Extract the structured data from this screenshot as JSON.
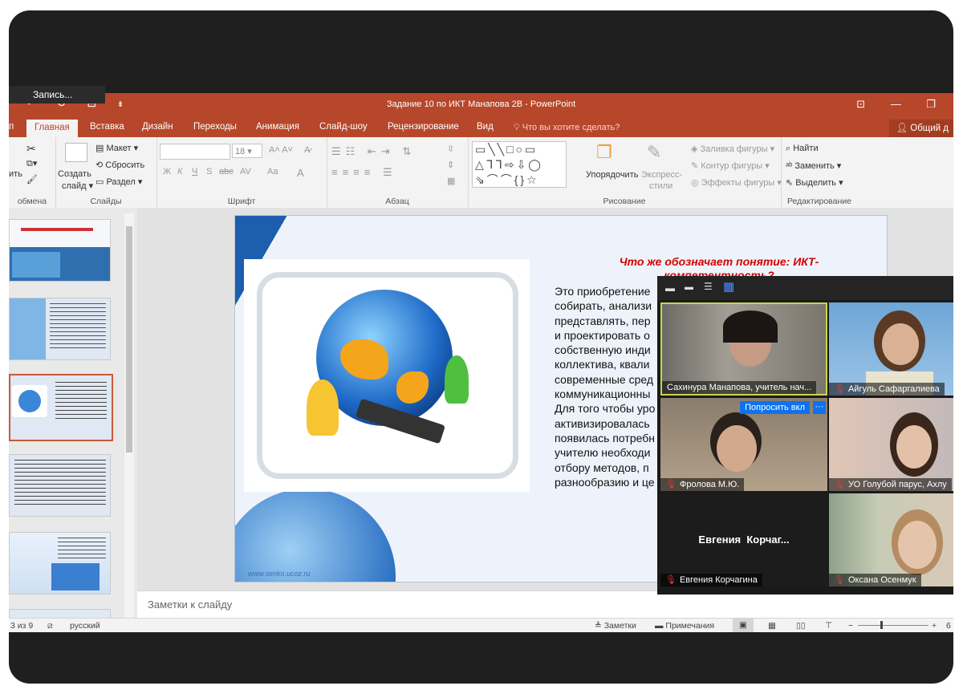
{
  "recording_label": "Запись...",
  "window": {
    "title": "Задание 10 по ИКТ Манапова 2В - PowerPoint",
    "controls": [
      "⊡",
      "—",
      "❐"
    ]
  },
  "qat": {
    "undo": "↶",
    "redo": "↻",
    "present": "⊡",
    "more": "⇟"
  },
  "tabs": {
    "file_stub": "п",
    "home": "Главная",
    "insert": "Вставка",
    "design": "Дизайн",
    "transitions": "Переходы",
    "animation": "Анимация",
    "slideshow": "Слайд-шоу",
    "review": "Рецензирование",
    "view": "Вид",
    "tell_me": "Что вы хотите сделать?",
    "share": "Общий д"
  },
  "ribbon": {
    "clipboard": {
      "paste_stub": "ить",
      "label": "обмена"
    },
    "slides": {
      "new_slide": "Создать",
      "new_slide_2": "слайд",
      "layout": "Макет",
      "reset": "Сбросить",
      "section": "Раздел",
      "label": "Слайды"
    },
    "font": {
      "name": "",
      "size": "18",
      "label": "Шрифт",
      "bold": "Ж",
      "italic": "К",
      "underline": "Ч",
      "strike": "S",
      "abc": "abc",
      "spacing": "AV",
      "case": "Aa",
      "color": "A"
    },
    "paragraph": {
      "label": "Абзац"
    },
    "drawing": {
      "arrange": "Упорядочить",
      "quick_styles": "Экспресс-",
      "quick_styles_2": "стили",
      "fill": "Заливка фигуры",
      "outline": "Контур фигуры",
      "effects": "Эффекты фигуры",
      "label": "Рисование"
    },
    "editing": {
      "find": "Найти",
      "replace": "Заменить",
      "select": "Выделить",
      "label": "Редактирование"
    }
  },
  "slide": {
    "title": "Что же обозначает понятие: ИКТ-компетентность?",
    "title_line1": "Что же обозначает понятие: ИКТ-",
    "title_line2": "компетентность?",
    "body_lines": [
      "Это приобретение",
      "собирать, анализи",
      "представлять, пер",
      "и проектировать о",
      "собственную инди",
      "коллектива, квали",
      "современные сред",
      "коммуникационны",
      "Для того чтобы уро",
      "активизировалась",
      "появилась потребн",
      "учителю необходи",
      "отбору методов, п",
      "разнообразию и це"
    ],
    "website": "www.senko.ucoz.ru"
  },
  "notes_placeholder": "Заметки к слайду",
  "status": {
    "slide_count": "3 из 9",
    "language": "русский",
    "notes": "Заметки",
    "comments": "Примечания",
    "zoom_stub": "6"
  },
  "video": {
    "participants": [
      {
        "name": "Сахинура Манапова, учитель нач...",
        "muted": false
      },
      {
        "name": "Айгуль Сафаргалиева",
        "muted": true
      },
      {
        "name": "Фролова М.Ю.",
        "muted": true
      },
      {
        "name": "УО Голубой парус, Ахлу",
        "muted": true
      },
      {
        "name": "Евгения Корчагина",
        "muted": true
      },
      {
        "name": "Оксана Осенмук",
        "muted": true
      }
    ],
    "placeholder_name": "Евгения  Корчаг...",
    "ask_button": "Попросить вкл",
    "more_button": "···"
  },
  "colors": {
    "ppt_accent": "#b7472a",
    "zoom_blue": "#0e72ed",
    "slide_title_red": "#d60000"
  }
}
